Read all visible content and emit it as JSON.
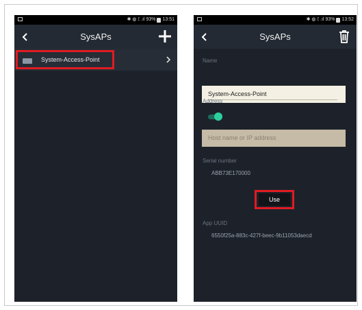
{
  "left": {
    "status": {
      "icons": "✱ ◍ ⟟ .ıl",
      "battery_pct": "93%",
      "time": "13:51"
    },
    "appbar": {
      "title": "SysAPs",
      "back_icon": "chevron-left-icon",
      "add_icon": "plus-icon"
    },
    "list": [
      {
        "label": "System-Access-Point",
        "icon": "device-icon",
        "chevron": "chevron-right-icon"
      }
    ]
  },
  "right": {
    "status": {
      "icons": "✱ ◍ ⟟ .ıl",
      "battery_pct": "93%",
      "time": "13:52"
    },
    "appbar": {
      "title": "SysAPs",
      "back_icon": "chevron-left-icon",
      "delete_icon": "trash-icon"
    },
    "form": {
      "name_label": "Name",
      "name_value": "System-Access-Point",
      "address_label": "Address",
      "address_toggle_on": true,
      "host_placeholder": "Host name or IP address",
      "serial_label": "Serial number",
      "serial_value": "ABB73E170000",
      "use_button": "Use",
      "uuid_label": "App UUID",
      "uuid_value": "6550f25a-883c-427f-beec-9b11053daecd"
    }
  },
  "colors": {
    "background": "#1d222a",
    "appbar": "#242a33",
    "highlight": "#e11b22",
    "toggle_on": "#2ecf9e"
  }
}
